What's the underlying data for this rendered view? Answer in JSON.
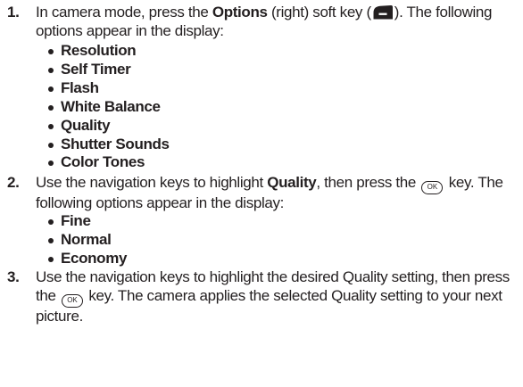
{
  "steps": [
    {
      "number": "1",
      "line1_pre": "In camera mode, press the ",
      "line1_bold": "Options",
      "line1_mid": " (right) soft key (",
      "line1_post": "). The following",
      "line2": "options appear in the display:",
      "options": [
        "Resolution",
        "Self Timer",
        "Flash",
        "White Balance",
        "Quality",
        "Shutter Sounds",
        "Color Tones"
      ]
    },
    {
      "number": "2",
      "line1_pre": "Use the navigation keys to highlight ",
      "line1_bold": "Quality",
      "line1_mid": ", then press the ",
      "line1_post": " key. The",
      "line2": "following options appear in the display:",
      "options": [
        "Fine",
        "Normal",
        "Economy"
      ]
    },
    {
      "number": "3",
      "line1": "Use the navigation keys to highlight the desired Quality setting, then press",
      "line2_pre": "the ",
      "line2_post": " key. The camera applies the selected Quality setting to your next",
      "line3": "picture."
    }
  ],
  "ok_key_label": "OK",
  "icons": {
    "soft_key": "right-soft-key-icon",
    "ok_key": "ok-key-icon"
  }
}
